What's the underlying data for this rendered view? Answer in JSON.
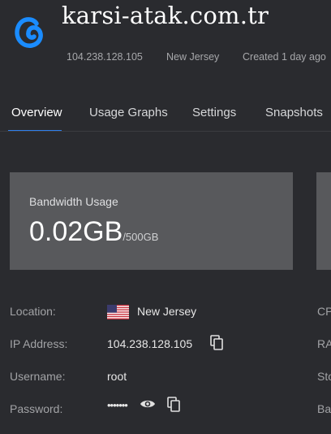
{
  "server": {
    "name": "karsi-atak.com.tr",
    "ip": "104.238.128.105",
    "location": "New Jersey",
    "created": "Created 1 day ago",
    "logo_icon": "debian-swirl-icon",
    "logo_color": "#1a8cff"
  },
  "tabs": [
    {
      "label": "Overview",
      "active": true
    },
    {
      "label": "Usage Graphs",
      "active": false
    },
    {
      "label": "Settings",
      "active": false
    },
    {
      "label": "Snapshots",
      "active": false
    }
  ],
  "bandwidth": {
    "title": "Bandwidth Usage",
    "used": "0.02GB",
    "total": "/500GB"
  },
  "details": {
    "location_label": "Location:",
    "location_value": "New Jersey",
    "location_flag": "us-flag-icon",
    "ip_label": "IP Address:",
    "ip_value": "104.238.128.105",
    "username_label": "Username:",
    "username_value": "root",
    "password_label": "Password:",
    "password_value": "•••••••"
  },
  "second_column_labels": [
    "CP",
    "RA",
    "Sto",
    "Ba"
  ],
  "colors": {
    "background": "#2a2b2f",
    "card": "#58595c",
    "accent": "#2f80ed"
  }
}
